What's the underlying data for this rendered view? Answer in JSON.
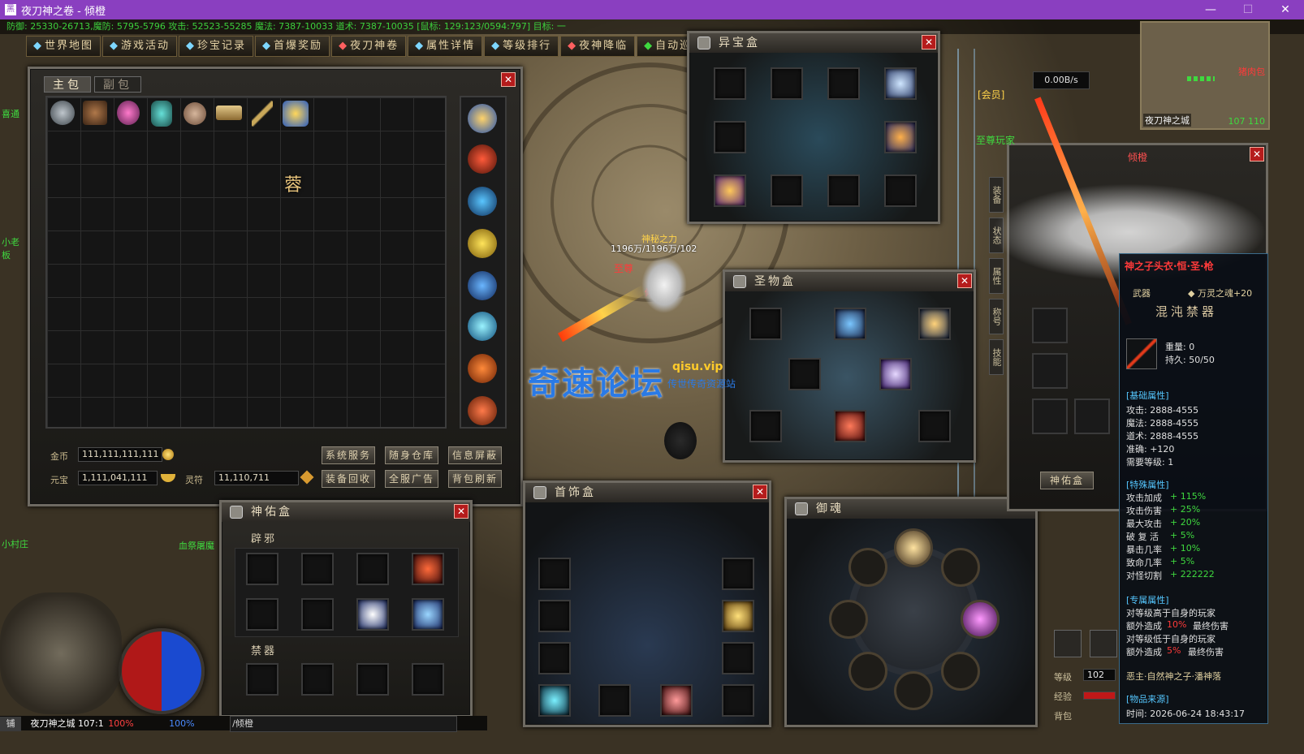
{
  "window": {
    "title": "夜刀神之卷 - 倾橙",
    "icon_text": "黑",
    "minimize": "—",
    "maximize": "☐",
    "close": "✕"
  },
  "status_line": "防御: 25330-26713,魔防: 5795-5796 攻击: 52523-55285 魔法: 7387-10033 道术: 7387-10035 [鼠标: 129:123/0594:797] 目标: 一",
  "top_menu": [
    "世界地图",
    "游戏活动",
    "珍宝记录",
    "首爆奖励",
    "夜刀神卷",
    "属性详情",
    "等级排行",
    "夜神降临",
    "自动巡航"
  ],
  "bag": {
    "tab_main": "主包",
    "tab_sub": "副包",
    "gold_label": "金币",
    "gold_value": "111,111,111,111",
    "yuanbao_label": "元宝",
    "yuanbao_value": "1,111,041,111",
    "lingfu_label": "灵符",
    "lingfu_value": "11,110,711",
    "buttons": [
      "系统服务",
      "随身仓库",
      "信息屏蔽",
      "装备回收",
      "全服广告",
      "背包刷新"
    ],
    "item_glyph": "蓉"
  },
  "yibao": {
    "title": "异宝盒"
  },
  "shengwu": {
    "title": "圣物盒"
  },
  "shouyou": {
    "title": "神佑盒",
    "section1": "辟邪",
    "section2": "禁器"
  },
  "shoushi": {
    "title": "首饰盒"
  },
  "yuhun": {
    "title": "御魂"
  },
  "net_speed": "0.00B/s",
  "minimap": {
    "map_name": "夜刀神之城",
    "coords": "107 110",
    "npc": "猪肉包"
  },
  "side_window": {
    "tab_label": "倾橙",
    "side_tabs": [
      "装备",
      "状态",
      "属性",
      "称号",
      "技能"
    ],
    "button": "神佑盒"
  },
  "player": {
    "name": "倾橙",
    "title": "至尊",
    "hp_text": "1196万/1196万/102",
    "guild": "神秘之力"
  },
  "watermark": {
    "main": "奇速论坛",
    "site": "qisu.vip",
    "sub": "传世传奇资源站"
  },
  "tooltip": {
    "name": "神之子头衣·恒·圣·枪",
    "type": "武器",
    "suffix": "◆ 万灵之魂+20",
    "rank": "混沌禁器",
    "weight": "重量: 0",
    "durability": "持久: 50/50",
    "base_title": "[基础属性]",
    "base": [
      "攻击: 2888-4555",
      "魔法: 2888-4555",
      "道术: 2888-4555",
      "准确: +120",
      "需要等级: 1"
    ],
    "special_title": "[特殊属性]",
    "special": [
      {
        "k": "攻击加成",
        "v": "+ 115%"
      },
      {
        "k": "攻击伤害",
        "v": "+ 25%"
      },
      {
        "k": "最大攻击",
        "v": "+ 20%"
      },
      {
        "k": "破 复 活",
        "v": "+ 5%"
      },
      {
        "k": "暴击几率",
        "v": "+ 10%"
      },
      {
        "k": "致命几率",
        "v": "+ 5%"
      },
      {
        "k": "对怪切割",
        "v": "+ 222222"
      }
    ],
    "exclusive_title": "[专属属性]",
    "exclusive": [
      "对等级高于自身的玩家",
      "额外造成",
      "10%",
      "最终伤害",
      "对等级低于自身的玩家",
      "额外造成",
      "5%",
      "最终伤害"
    ],
    "owner": "恶主·自然神之子·潘神落",
    "source_title": "[物品来源]",
    "time": "时间: 2026-06-24 18:43:17"
  },
  "bottom": {
    "map": "夜刀神之城 107:1",
    "hp_pct": "100%",
    "mp_pct": "100%",
    "chat": "/倾橙",
    "shop": "铺"
  },
  "side_stats": {
    "level_label": "等级",
    "level": "102",
    "exp_label": "经验",
    "bag_label": "背包"
  },
  "left_edge": [
    "喜通",
    "小老板",
    "小村庄"
  ],
  "npc_labels": {
    "vip": "[会员]",
    "supreme": "至尊玩家",
    "bottom_npc": "血祭屠魔"
  }
}
